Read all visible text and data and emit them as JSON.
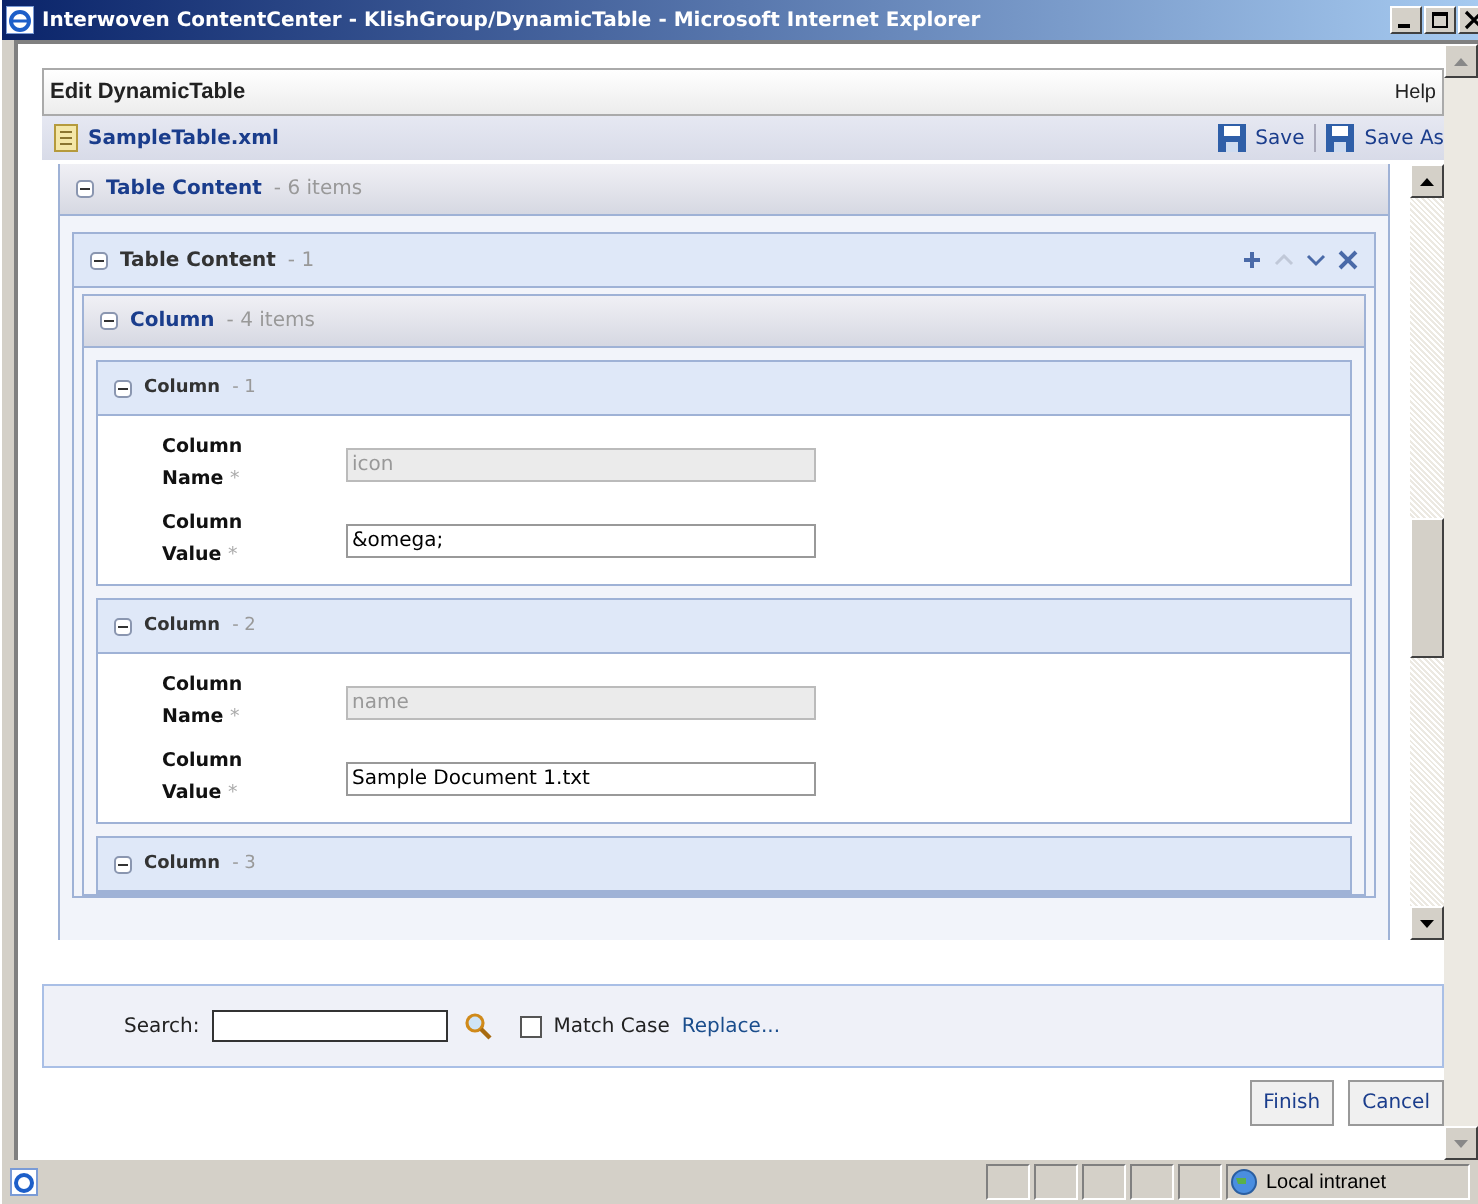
{
  "window": {
    "title": "Interwoven ContentCenter - KlishGroup/DynamicTable - Microsoft Internet Explorer"
  },
  "header": {
    "title": "Edit DynamicTable",
    "help": "Help"
  },
  "file": {
    "name": "SampleTable.xml",
    "save": "Save",
    "save_as": "Save As"
  },
  "outer_section": {
    "title": "Table Content",
    "count": "- 6 items",
    "expanded": true
  },
  "inner_section": {
    "title": "Table Content",
    "count": "- 1",
    "expanded": true
  },
  "column_group": {
    "title": "Column",
    "count": "- 4 items",
    "expanded": true
  },
  "columns": [
    {
      "title": "Column",
      "index": "- 1",
      "expanded": true,
      "fields": [
        {
          "label": "Column Name",
          "required": "*",
          "value": "icon",
          "disabled": true
        },
        {
          "label": "Column Value",
          "required": "*",
          "value": "&omega;",
          "disabled": false
        }
      ]
    },
    {
      "title": "Column",
      "index": "- 2",
      "expanded": true,
      "fields": [
        {
          "label": "Column Name",
          "required": "*",
          "value": "name",
          "disabled": true
        },
        {
          "label": "Column Value",
          "required": "*",
          "value": "Sample Document 1.txt",
          "disabled": false
        }
      ]
    },
    {
      "title": "Column",
      "index": "- 3",
      "expanded": true
    }
  ],
  "search": {
    "label": "Search:",
    "match_case": {
      "label": "Match Case",
      "checked": false
    },
    "replace": "Replace..."
  },
  "buttons": [
    "Finish",
    "Cancel"
  ],
  "status_bar": {
    "zone": "Local intranet"
  }
}
